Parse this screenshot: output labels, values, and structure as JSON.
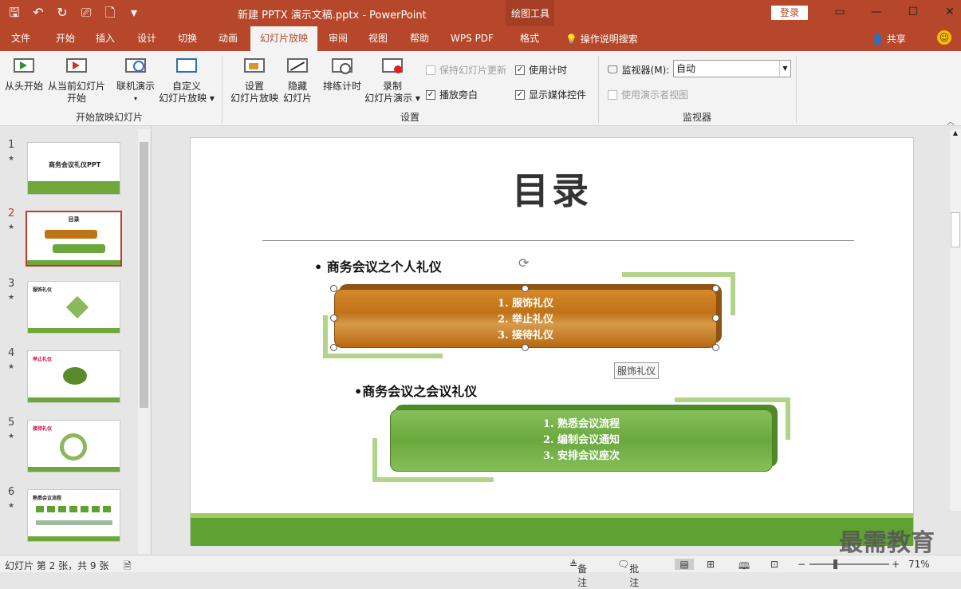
{
  "app": {
    "doc_title": "新建 PPTX 演示文稿.pptx  -  PowerPoint",
    "context_tools": "绘图工具",
    "login": "登录",
    "share": "共享",
    "search": "操作说明搜索",
    "brand_color": "#b7472a"
  },
  "tabs": [
    {
      "label": "文件"
    },
    {
      "label": "开始"
    },
    {
      "label": "插入"
    },
    {
      "label": "设计"
    },
    {
      "label": "切换"
    },
    {
      "label": "动画"
    },
    {
      "label": "幻灯片放映"
    },
    {
      "label": "审阅"
    },
    {
      "label": "视图"
    },
    {
      "label": "帮助"
    },
    {
      "label": "WPS PDF"
    },
    {
      "label": "格式"
    }
  ],
  "ribbon": {
    "from_start": "从头开始",
    "from_current_1": "从当前幻灯片",
    "from_current_2": "开始",
    "online_1": "联机演示",
    "custom_1": "自定义",
    "custom_2": "幻灯片放映",
    "group_start": "开始放映幻灯片",
    "setup_1": "设置",
    "setup_2": "幻灯片放映",
    "hide_1": "隐藏",
    "hide_2": "幻灯片",
    "rehearse": "排练计时",
    "record_1": "录制",
    "record_2": "幻灯片演示",
    "keep_updated": "保持幻灯片更新",
    "use_timings": "使用计时",
    "play_narr": "播放旁白",
    "show_media": "显示媒体控件",
    "group_setup": "设置",
    "monitor_label": "监视器(M):",
    "monitor_value": "自动",
    "presenter_view": "使用演示者视图",
    "group_monitor": "监视器"
  },
  "thumbs": [
    {
      "num": "1",
      "title": "商务会议礼仪PPT"
    },
    {
      "num": "2",
      "title": "目录"
    },
    {
      "num": "3",
      "title": "服饰礼仪"
    },
    {
      "num": "4",
      "title": "举止礼仪"
    },
    {
      "num": "5",
      "title": "接待礼仪"
    },
    {
      "num": "6",
      "title": "熟悉会议流程"
    }
  ],
  "slide": {
    "title": "目录",
    "bullet1": "商务会议之个人礼仪",
    "bullet2": "商务会议之会议礼仪",
    "orange_items": [
      "1.  服饰礼仪",
      "2.  举止礼仪",
      "3.  接待礼仪"
    ],
    "green_items": [
      "1.  熟悉会议流程",
      "2.  编制会议通知",
      "3.  安排会议座次"
    ],
    "tooltip": "服饰礼仪"
  },
  "status": {
    "slide_pos": "幻灯片 第 2 张，共 9 张",
    "notes": "备注",
    "comments": "批注",
    "zoom": "71%",
    "zoom_fraction": 0.71
  },
  "watermark": "最需教育"
}
